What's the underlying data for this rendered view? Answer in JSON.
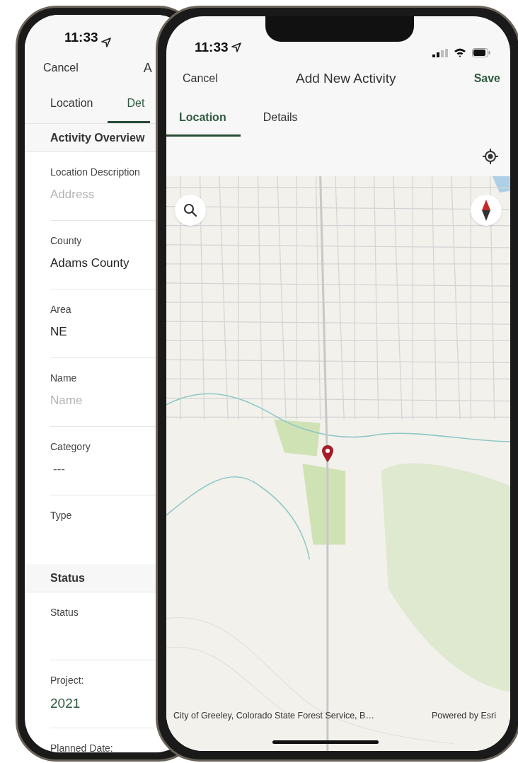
{
  "back_phone": {
    "status_time": "11:33",
    "nav": {
      "cancel": "Cancel",
      "title": "A"
    },
    "tabs": [
      {
        "label": "Location",
        "selected": false
      },
      {
        "label": "Det",
        "selected": true
      }
    ],
    "sections": [
      {
        "header": "Activity Overview",
        "fields": [
          {
            "label": "Location Description",
            "placeholder": "Address",
            "kind": "placeholder"
          },
          {
            "label": "County",
            "value": "Adams County",
            "kind": "value"
          },
          {
            "label": "Area",
            "value": "NE",
            "kind": "value"
          },
          {
            "label": "Name",
            "placeholder": "Name",
            "kind": "placeholder"
          },
          {
            "label": "Category",
            "value": "---",
            "kind": "muted"
          },
          {
            "label": "Type",
            "kind": "empty"
          }
        ]
      },
      {
        "header": "Status",
        "fields": [
          {
            "label": "Status",
            "kind": "empty"
          },
          {
            "label": "Project:",
            "value": "2021",
            "kind": "accent"
          },
          {
            "label": "Planned Date:",
            "kind": "empty"
          }
        ]
      }
    ]
  },
  "front_phone": {
    "status_time": "11:33",
    "nav": {
      "cancel": "Cancel",
      "title": "Add New Activity",
      "save": "Save"
    },
    "tabs": [
      {
        "label": "Location",
        "selected": true
      },
      {
        "label": "Details",
        "selected": false
      }
    ],
    "map": {
      "attribution": "City of Greeley, Colorado State Forest Service, B…",
      "credit": "Powered by Esri"
    }
  }
}
